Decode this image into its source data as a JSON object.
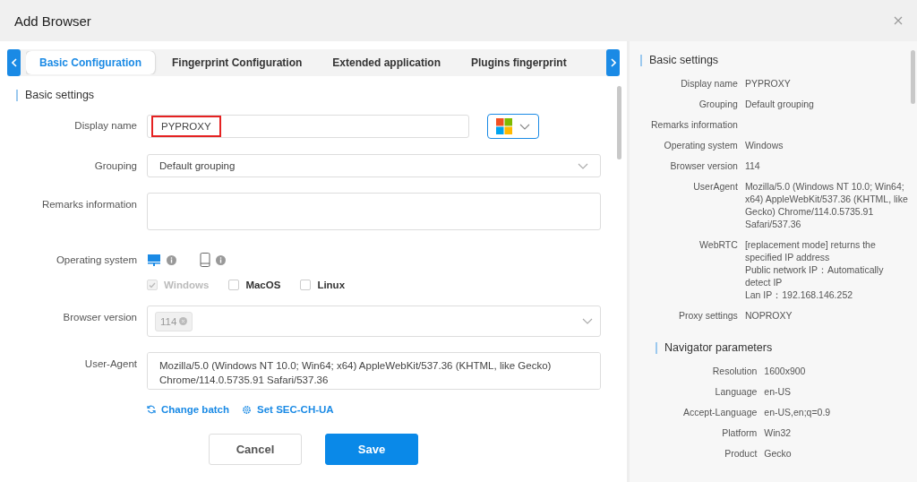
{
  "window": {
    "title": "Add Browser"
  },
  "tabs": [
    {
      "label": "Basic Configuration",
      "selected": true
    },
    {
      "label": "Fingerprint Configuration",
      "selected": false
    },
    {
      "label": "Extended application",
      "selected": false
    },
    {
      "label": "Plugins fingerprint",
      "selected": false
    }
  ],
  "form": {
    "section": "Basic settings",
    "display_name": {
      "label": "Display name",
      "value": "PYPROXY",
      "highlighted": true
    },
    "grouping": {
      "label": "Grouping",
      "value": "Default grouping"
    },
    "remarks": {
      "label": "Remarks information"
    },
    "operating_system": {
      "label": "Operating system",
      "device_types": [
        {
          "kind": "desktop",
          "selected": true
        },
        {
          "kind": "mobile",
          "selected": false
        }
      ],
      "options": [
        {
          "label": "Windows",
          "checked": true,
          "disabled": true
        },
        {
          "label": "MacOS",
          "checked": false,
          "disabled": false
        },
        {
          "label": "Linux",
          "checked": false,
          "disabled": false
        }
      ]
    },
    "browser_version": {
      "label": "Browser version",
      "tags": [
        "114"
      ]
    },
    "user_agent": {
      "label": "User-Agent",
      "value": "Mozilla/5.0 (Windows NT 10.0; Win64; x64) AppleWebKit/537.36 (KHTML, like Gecko) Chrome/114.0.5735.91 Safari/537.36"
    },
    "links": [
      {
        "kind": "refresh",
        "label": "Change batch"
      },
      {
        "kind": "gear",
        "label": "Set SEC-CH-UA"
      }
    ],
    "buttons": [
      {
        "label": "Cancel",
        "primary": false
      },
      {
        "label": "Save",
        "primary": true
      }
    ]
  },
  "summary": [
    {
      "title": "Basic settings",
      "rows": [
        {
          "label": "Display name",
          "lines": [
            "PYPROXY"
          ]
        },
        {
          "label": "Grouping",
          "lines": [
            "Default grouping"
          ]
        },
        {
          "label": "Remarks information",
          "lines": []
        },
        {
          "label": "Operating system",
          "lines": [
            "Windows"
          ]
        },
        {
          "label": "Browser version",
          "lines": [
            "114"
          ]
        },
        {
          "label": "UserAgent",
          "lines": [
            "Mozilla/5.0 (Windows NT 10.0; Win64; x64) AppleWebKit/537.36 (KHTML, like Gecko) Chrome/114.0.5735.91 Safari/537.36"
          ]
        },
        {
          "label": "WebRTC",
          "lines": [
            "[replacement mode] returns the specified IP address",
            "Public network IP：Automatically detect IP",
            "Lan IP：192.168.146.252"
          ]
        },
        {
          "label": "Proxy settings",
          "lines": [
            "NOPROXY"
          ]
        }
      ]
    },
    {
      "title": "Navigator parameters",
      "rows": [
        {
          "label": "Resolution",
          "lines": [
            "1600x900"
          ]
        },
        {
          "label": "Language",
          "lines": [
            "en-US"
          ]
        },
        {
          "label": "Accept-Language",
          "lines": [
            "en-US,en;q=0.9"
          ]
        },
        {
          "label": "Platform",
          "lines": [
            "Win32"
          ]
        },
        {
          "label": "Product",
          "lines": [
            "Gecko"
          ]
        }
      ]
    }
  ]
}
